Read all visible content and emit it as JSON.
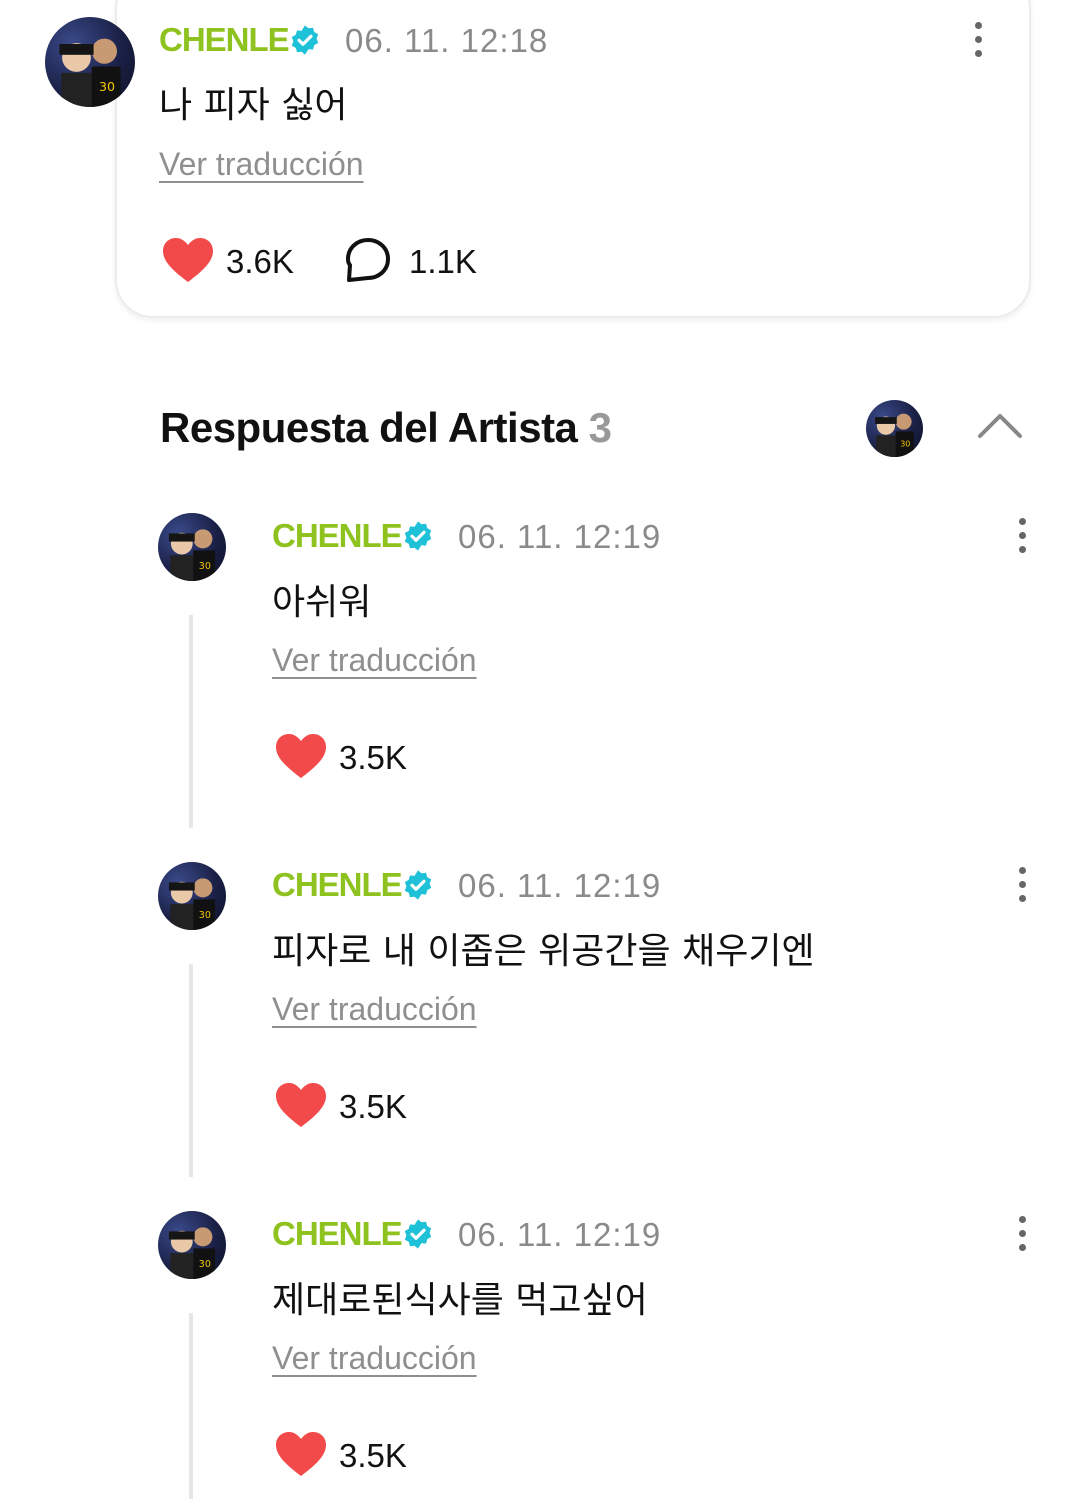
{
  "post": {
    "author": "CHENLE",
    "timestamp": "06. 11. 12:18",
    "text": "나 피자 싫어",
    "translate_label": "Ver traducción",
    "likes": "3.6K",
    "comments": "1.1K"
  },
  "artist_replies": {
    "title": "Respuesta del Artista",
    "count": "3"
  },
  "replies": [
    {
      "author": "CHENLE",
      "timestamp": "06. 11. 12:19",
      "text": "아쉬워",
      "translate_label": "Ver traducción",
      "likes": "3.5K"
    },
    {
      "author": "CHENLE",
      "timestamp": "06. 11. 12:19",
      "text": "피자로 내 이좁은 위공간을 채우기엔",
      "translate_label": "Ver traducción",
      "likes": "3.5K"
    },
    {
      "author": "CHENLE",
      "timestamp": "06. 11. 12:19",
      "text": "제대로된식사를 먹고싶어",
      "translate_label": "Ver traducción",
      "likes": "3.5K"
    }
  ],
  "colors": {
    "name": "#8dc21f",
    "verified": "#1fc1d8",
    "heart": "#f24a4a",
    "muted": "#8a8a8a"
  },
  "icons": [
    "verified-badge-icon",
    "more-vertical-icon",
    "heart-icon",
    "comment-bubble-icon",
    "chevron-up-icon"
  ]
}
